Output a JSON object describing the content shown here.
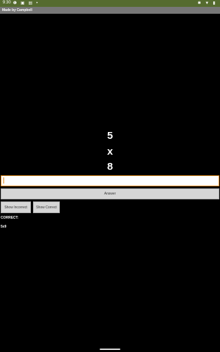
{
  "status": {
    "time": "9:30",
    "left_icons": "❶ ▣ ▤ •",
    "right_icons": "✱ ▼ ▮"
  },
  "app": {
    "title": "Made by Campbell"
  },
  "problem": {
    "first": "5",
    "operator": "x",
    "second": "8"
  },
  "answer": {
    "value": "",
    "placeholder": "",
    "button_label": "Answer"
  },
  "buttons": {
    "show_incorrect": "Show Incorrect",
    "show_correct": "Show Correct"
  },
  "results": {
    "correct_label": "CORRECT:",
    "correct_items": "5x9"
  },
  "colors": {
    "status_bar": "#556b2f",
    "title_bar": "#777777",
    "input_border": "#e08a1e"
  }
}
